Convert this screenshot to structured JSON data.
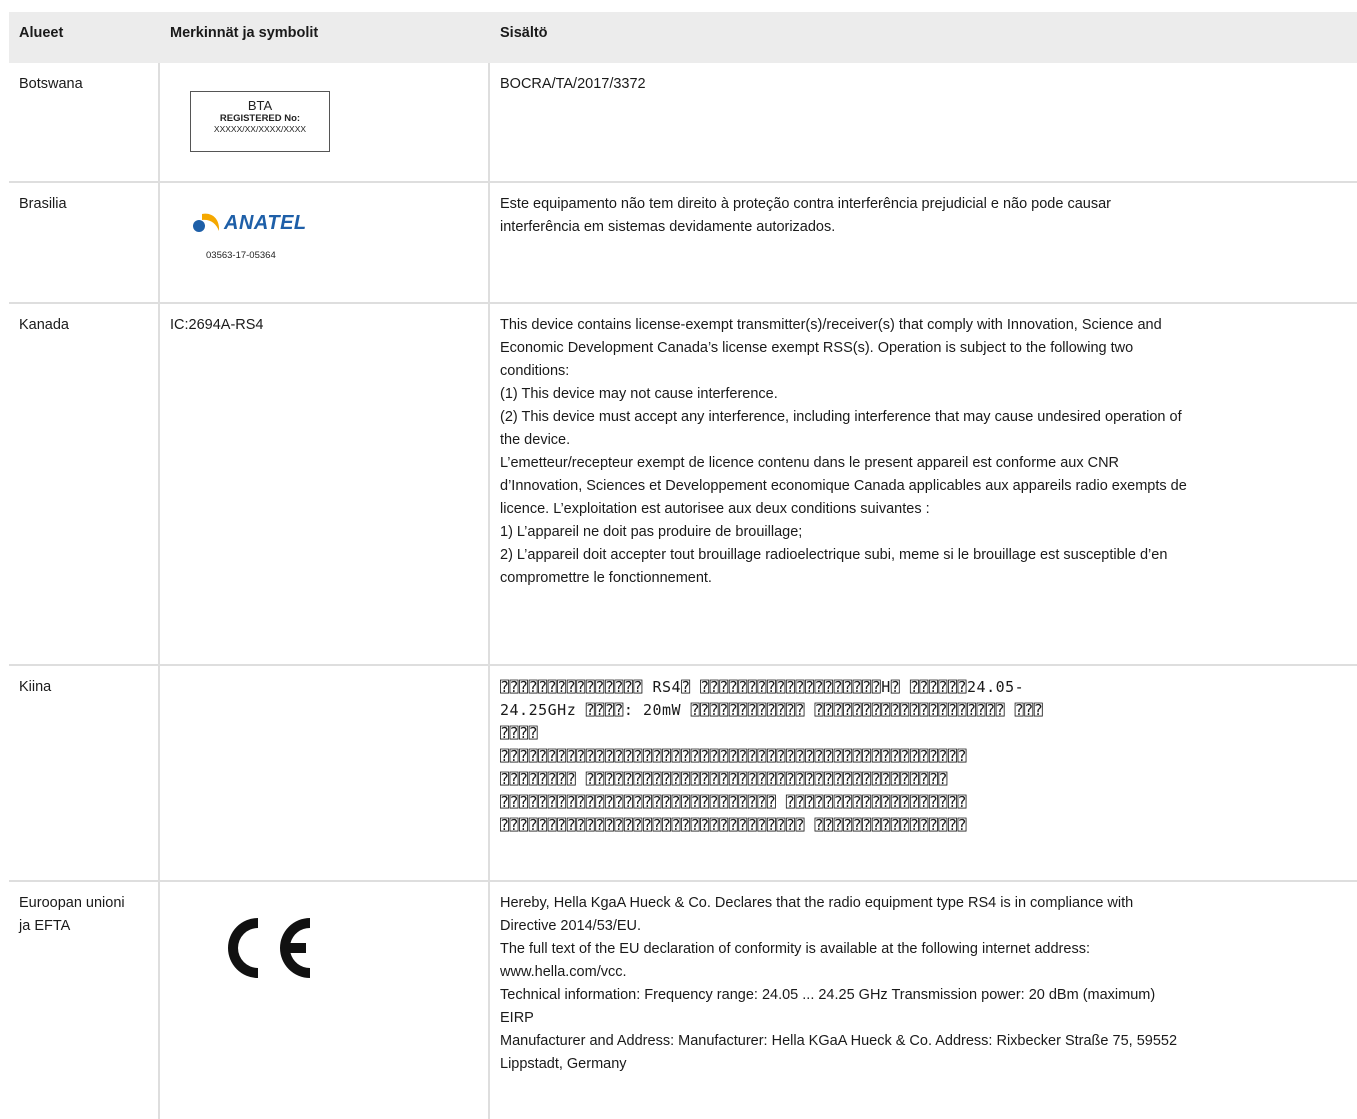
{
  "header": {
    "col1": "Alueet",
    "col2": "Merkinnät ja symbolit",
    "col3": "Sisältö"
  },
  "rows": [
    {
      "region": "Botswana",
      "symbol": {
        "type": "bta-label",
        "title": "BTA",
        "registered": "REGISTERED No:",
        "number": "XXXXX/XX/XXXX/XXXX"
      },
      "content": [
        "BOCRA/TA/2017/3372"
      ]
    },
    {
      "region": "Brasilia",
      "symbol": {
        "type": "anatel-logo",
        "brand": "ANATEL",
        "number": "03563-17-05364",
        "brand_color": "#1e5fa8",
        "accent_color": "#f5a800"
      },
      "content": [
        "Este equipamento não tem direito à proteção contra interferência prejudicial e não pode causar",
        "interferência em sistemas devidamente autorizados."
      ]
    },
    {
      "region": "Kanada",
      "symbol_text": "IC:2694A-RS4",
      "content": [
        "This device contains license-exempt transmitter(s)/receiver(s) that comply with Innovation, Science and",
        "Economic Development Canada’s license exempt RSS(s). Operation is subject to the following two",
        "conditions:",
        "(1) This device may not cause interference.",
        "(2) This device must accept any interference, including interference that may cause undesired operation of",
        "the device.",
        "L’emetteur/recepteur exempt de licence contenu dans le present appareil est conforme aux CNR",
        "d’Innovation, Sciences et Developpement economique Canada applicables aux appareils radio exempts de",
        "licence. L’exploitation est autorisee aux deux conditions suivantes :",
        "1) L’appareil ne doit pas produire de brouillage;",
        "2) L’appareil doit accepter tout brouillage radioelectrique subi, meme si le brouillage est susceptible d’en",
        "compromettre le fonctionnement."
      ]
    },
    {
      "region": "Kiina",
      "content": [
        "⍰⍰⍰⍰⍰⍰⍰⍰⍰⍰⍰⍰⍰⍰⍰ RS4⍰ ⍰⍰⍰⍰⍰⍰⍰⍰⍰⍰⍰⍰⍰⍰⍰⍰⍰⍰⍰H⍰ ⍰⍰⍰⍰⍰⍰24.05-",
        "24.25GHz ⍰⍰⍰⍰: 20mW ⍰⍰⍰⍰⍰⍰⍰⍰⍰⍰⍰⍰ ⍰⍰⍰⍰⍰⍰⍰⍰⍰⍰⍰⍰⍰⍰⍰⍰⍰⍰⍰⍰ ⍰⍰⍰",
        "⍰⍰⍰⍰",
        "⍰⍰⍰⍰⍰⍰⍰⍰⍰⍰⍰⍰⍰⍰⍰⍰⍰⍰⍰⍰⍰⍰⍰⍰⍰⍰⍰⍰⍰⍰⍰⍰⍰⍰⍰⍰⍰⍰⍰⍰⍰⍰⍰⍰⍰⍰⍰⍰⍰",
        "⍰⍰⍰⍰⍰⍰⍰⍰ ⍰⍰⍰⍰⍰⍰⍰⍰⍰⍰⍰⍰⍰⍰⍰⍰⍰⍰⍰⍰⍰⍰⍰⍰⍰⍰⍰⍰⍰⍰⍰⍰⍰⍰⍰⍰⍰⍰",
        "⍰⍰⍰⍰⍰⍰⍰⍰⍰⍰⍰⍰⍰⍰⍰⍰⍰⍰⍰⍰⍰⍰⍰⍰⍰⍰⍰⍰⍰ ⍰⍰⍰⍰⍰⍰⍰⍰⍰⍰⍰⍰⍰⍰⍰⍰⍰⍰⍰",
        "⍰⍰⍰⍰⍰⍰⍰⍰⍰⍰⍰⍰⍰⍰⍰⍰⍰⍰⍰⍰⍰⍰⍰⍰⍰⍰⍰⍰⍰⍰⍰⍰ ⍰⍰⍰⍰⍰⍰⍰⍰⍰⍰⍰⍰⍰⍰⍰⍰"
      ]
    },
    {
      "region_lines": [
        "Euroopan unioni",
        "ja EFTA"
      ],
      "symbol": {
        "type": "ce-mark"
      },
      "content": [
        "Hereby, Hella KgaA Hueck & Co. Declares that the radio equipment type RS4 is in compliance with",
        "Directive 2014/53/EU.",
        "The full text of the EU declaration of conformity is available at the following internet address:",
        "www.hella.com/vcc.",
        "Technical information: Frequency range: 24.05 ... 24.25 GHz Transmission power: 20 dBm (maximum)",
        "EIRP",
        "Manufacturer and Address: Manufacturer: Hella KGaA Hueck & Co. Address: Rixbecker Straße 75, 59552",
        "Lippstadt, Germany"
      ]
    }
  ]
}
